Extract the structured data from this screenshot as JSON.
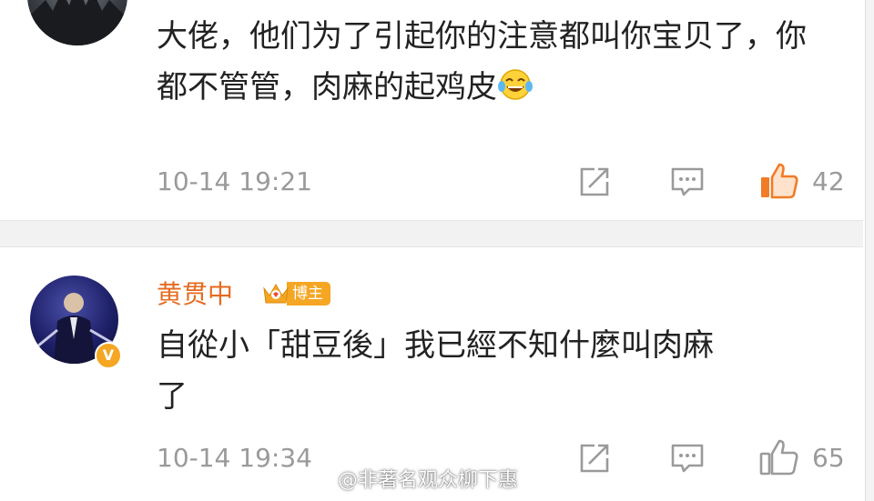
{
  "comments": [
    {
      "text": "大佬，他们为了引起你的注意都叫你宝贝了，你都不管管，肉麻的起鸡皮",
      "emoji": "laughing-tears-emoji",
      "time": "10-14 19:21",
      "likes": "42",
      "liked": true
    },
    {
      "username": "黄贯中",
      "badge": "博主",
      "verified_badge": "V",
      "text_line1": "自從小「甜豆後」我已經不知什麼叫肉麻",
      "text_line2": "了",
      "time": "10-14 19:34",
      "likes": "65",
      "liked": false
    }
  ],
  "watermark": "@非著名观众柳下惠",
  "colors": {
    "username": "#e56a1e",
    "liked": "#f07c28",
    "meta": "#9a9a9a",
    "badge": "#f5a623"
  },
  "icons": [
    "share-icon",
    "reply-icon",
    "like-icon",
    "crown-icon",
    "weibo-icon"
  ]
}
